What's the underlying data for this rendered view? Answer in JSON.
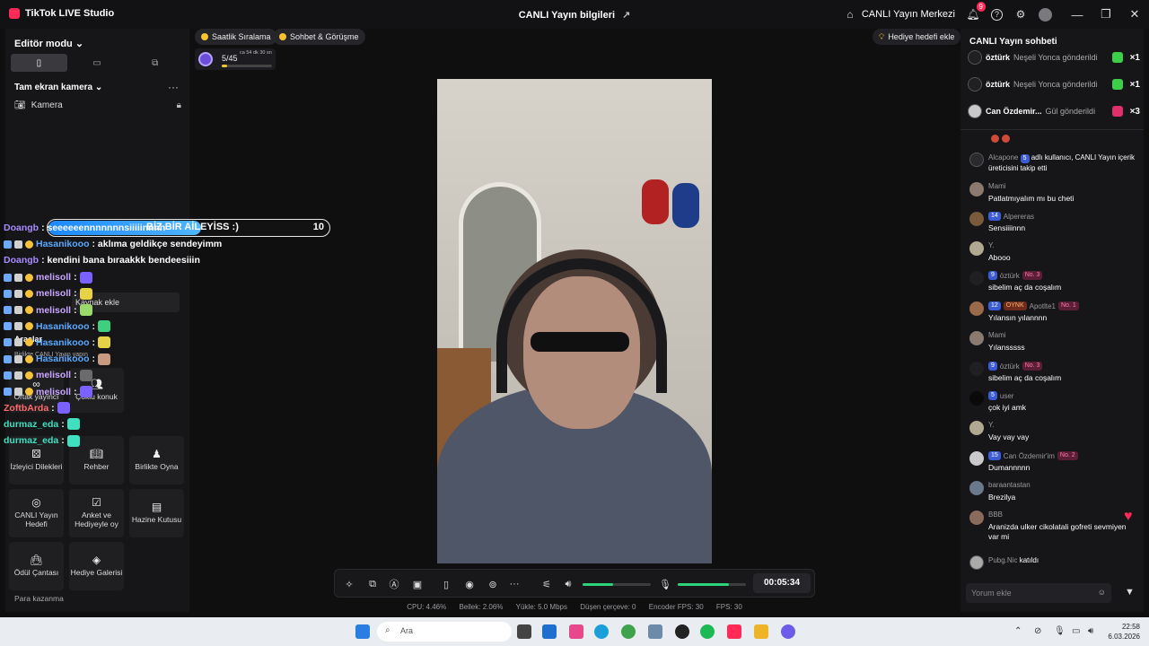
{
  "app": {
    "title": "TikTok LIVE Studio",
    "center_title": "CANLI Yayın bilgileri",
    "live_center": "CANLI Yayın Merkezi",
    "notif_count": "9"
  },
  "left": {
    "editor_mode": "Editör modu",
    "scene": "Tam ekran kamera",
    "camera": "Kamera",
    "add_source": "Kaynak ekle",
    "tools_label": "Araçlar",
    "together_label": "Birlikte CANLI Yayın yapın",
    "co_host": "Ortak yayıncı",
    "multi_guest": "Çoklu konuk",
    "tools": [
      {
        "label": "İzleyici Dilekleri",
        "icon": "wish-icon"
      },
      {
        "label": "Rehber",
        "icon": "guide-icon"
      },
      {
        "label": "Birlikte Oyna",
        "icon": "play-together-icon"
      },
      {
        "label": "CANLI Yayın Hedefi",
        "icon": "goal-icon"
      },
      {
        "label": "Anket ve Hediyeyle oy",
        "icon": "poll-icon"
      },
      {
        "label": "Hazine Kutusu",
        "icon": "treasure-icon"
      },
      {
        "label": "Ödül Çantası",
        "icon": "reward-bag-icon"
      },
      {
        "label": "Hediye Galerisi",
        "icon": "gift-gallery-icon"
      }
    ],
    "earn_label": "Para kazanma"
  },
  "overlay": {
    "banner_text": "BİZ BİR AİLEYİSS :)",
    "banner_count": "10",
    "lines": [
      {
        "user": "Doangb",
        "color": "#a98bff",
        "badges": false,
        "text": ": seeeeeennnnnnnsiiiiinnnn"
      },
      {
        "user": "Hasanikooo",
        "color": "#5aa9ff",
        "badges": true,
        "text": ": aklıma geldikçe sendeyimm"
      },
      {
        "user": "Doangb",
        "color": "#a98bff",
        "badges": false,
        "text": ": kendini bana bıraakkk bendeesiiin"
      },
      {
        "user": "melisoll",
        "color": "#c9a6ff",
        "badges": true,
        "text": ":"
      },
      {
        "user": "melisoll",
        "color": "#c9a6ff",
        "badges": true,
        "text": ":"
      },
      {
        "user": "melisoll",
        "color": "#c9a6ff",
        "badges": true,
        "text": ":"
      },
      {
        "user": "Hasanikooo",
        "color": "#5aa9ff",
        "badges": true,
        "text": ":"
      },
      {
        "user": "Hasanikooo",
        "color": "#5aa9ff",
        "badges": true,
        "text": ":"
      },
      {
        "user": "Hasanikooo",
        "color": "#5aa9ff",
        "badges": true,
        "text": ":"
      },
      {
        "user": "melisoll",
        "color": "#c9a6ff",
        "badges": true,
        "text": ":"
      },
      {
        "user": "melisoll",
        "color": "#c9a6ff",
        "badges": true,
        "text": ":"
      },
      {
        "user": "ZoftbArda",
        "color": "#ff6b6b",
        "badges": false,
        "text": ":"
      },
      {
        "user": "durmaz_eda",
        "color": "#3fe0c0",
        "badges": false,
        "text": ":"
      },
      {
        "user": "durmaz_eda",
        "color": "#3fe0c0",
        "badges": false,
        "text": ":"
      }
    ]
  },
  "top": {
    "chip_ranking": "Saatlik Sıralama",
    "chip_chat": "Sohbet & Görüşme",
    "goal_text": "5/45",
    "goal_sub": "ca 54 dk 30 sn",
    "goal_progress": 0.11,
    "gift_goal": "Hediye hedefi ekle"
  },
  "controls": {
    "timer": "00:05:34",
    "speaker_level": 0.45,
    "mic_level": 0.75
  },
  "stats": {
    "cpu": "CPU:  4.46%",
    "memory": "Bellek:  2.06%",
    "upload": "Yükle:  5.0 Mbps",
    "dropped": "Düşen çerçeve:  0",
    "encoder_fps": "Encoder FPS:  30",
    "fps": "FPS:  30"
  },
  "chat": {
    "title": "CANLI Yayın sohbeti",
    "gifts": [
      {
        "user": "öztürk",
        "action": "Neşeli Yonca gönderildi",
        "mult": "×1",
        "gem": "#3ecf4a",
        "av": "#202022"
      },
      {
        "user": "öztürk",
        "action": "Neşeli Yonca gönderildi",
        "mult": "×1",
        "gem": "#3ecf4a",
        "av": "#202022"
      },
      {
        "user": "Can Özdemir...",
        "action": "Gül gönderildi",
        "mult": "×3",
        "gem": "#e0306a",
        "av": "#c9c9cc"
      }
    ],
    "messages": [
      {
        "who": "Alcapone",
        "lv": "5",
        "no": "",
        "fan": "",
        "text": "adlı kullanıcı, CANLI Yayın içerik üreticisini takip etti",
        "inline": true,
        "av": "#2a2a2e"
      },
      {
        "who": "Mami",
        "lv": "",
        "no": "",
        "fan": "",
        "text": "Patlatmıyalım mı bu cheti",
        "av": "#8a7a70"
      },
      {
        "who": "Alpereras",
        "lv": "14",
        "no": "",
        "fan": "",
        "text": "Sensiiiinnn",
        "av": "#7a5a3a"
      },
      {
        "who": "Y.",
        "lv": "",
        "no": "",
        "fan": "",
        "text": "Abooo",
        "av": "#b0a890"
      },
      {
        "who": "öztürk",
        "lv": "9",
        "no": "No. 3",
        "fan": "",
        "text": "sibelim aç da coşalım",
        "av": "#202022"
      },
      {
        "who": "Apotlte1",
        "lv": "12",
        "no": "No. 1",
        "fan": "OYNK",
        "text": "Yılansın yılannnn",
        "av": "#9a6a4a"
      },
      {
        "who": "Mami",
        "lv": "",
        "no": "",
        "fan": "",
        "text": "Yılansssss",
        "av": "#8a7a70"
      },
      {
        "who": "öztürk",
        "lv": "9",
        "no": "No. 3",
        "fan": "",
        "text": "sibelim aç da coşalım",
        "av": "#202022"
      },
      {
        "who": "user",
        "lv": "5",
        "no": "",
        "fan": "",
        "text": "çok iyi amk",
        "av": "#0a0a0a"
      },
      {
        "who": "Y.",
        "lv": "",
        "no": "",
        "fan": "",
        "text": "Vay vay vay",
        "av": "#b0a890"
      },
      {
        "who": "Can Özdemir'im",
        "lv": "15",
        "no": "No. 2",
        "fan": "",
        "text": "Dumannnnn",
        "av": "#c9c9cc"
      },
      {
        "who": "baraantastan",
        "lv": "",
        "no": "",
        "fan": "",
        "text": "Brezilya",
        "av": "#6a7a8a"
      },
      {
        "who": "BBB",
        "lv": "",
        "no": "",
        "fan": "",
        "text": "Aranizda ulker cikolatali gofreti sevmiyen var mi",
        "av": "#8a6a5a"
      },
      {
        "who": "Pubg.Nic",
        "lv": "",
        "no": "",
        "fan": "",
        "text": "katıldı",
        "inline": true,
        "av": "#aaaaaa"
      }
    ],
    "comment_placeholder": "Yorum ekle"
  },
  "taskbar": {
    "search": "Ara",
    "time": "22:58",
    "date": "6.03.2026"
  }
}
